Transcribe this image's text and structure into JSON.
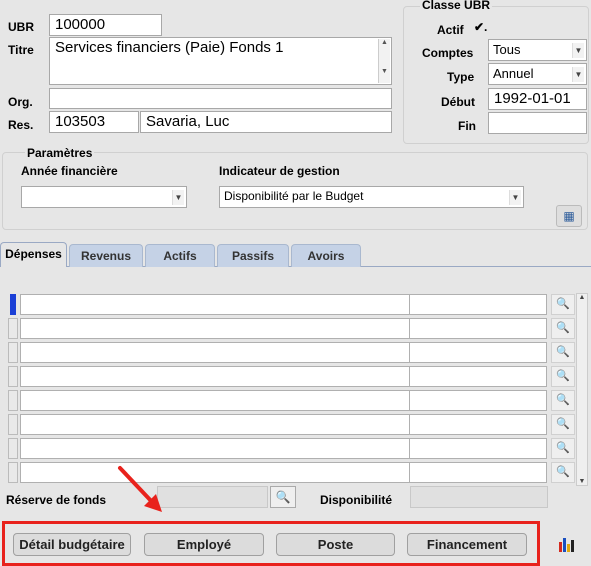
{
  "header": {
    "ubr_label": "UBR",
    "ubr_value": "100000",
    "titre_label": "Titre",
    "titre_value": "Services financiers (Paie) Fonds 1",
    "org_label": "Org.",
    "org_value": "",
    "res_label": "Res.",
    "res_code": "103503",
    "res_name": "Savaria, Luc"
  },
  "classe": {
    "title": "Classe UBR",
    "actif_label": "Actif",
    "actif_checked": true,
    "comptes_label": "Comptes",
    "comptes_value": "Tous",
    "type_label": "Type",
    "type_value": "Annuel",
    "debut_label": "Début",
    "debut_value": "1992-01-01",
    "fin_label": "Fin",
    "fin_value": ""
  },
  "parametres": {
    "title": "Paramètres",
    "annee_label": "Année financière",
    "annee_value": "",
    "indicateur_label": "Indicateur de gestion",
    "indicateur_value": "Disponibilité par le Budget"
  },
  "tabs": [
    "Dépenses",
    "Revenus",
    "Actifs",
    "Passifs",
    "Avoirs"
  ],
  "active_tab": "Dépenses",
  "grid_rows": 8,
  "reserve_label": "Réserve de fonds",
  "disponibilite_label": "Disponibilité",
  "buttons": {
    "detail": "Détail budgétaire",
    "employe": "Employé",
    "poste": "Poste",
    "financement": "Financement"
  },
  "colors": {
    "highlight_red": "#e8221c",
    "tab_blue": "#c5d2e6",
    "row_marker": "#1a3fd6"
  }
}
